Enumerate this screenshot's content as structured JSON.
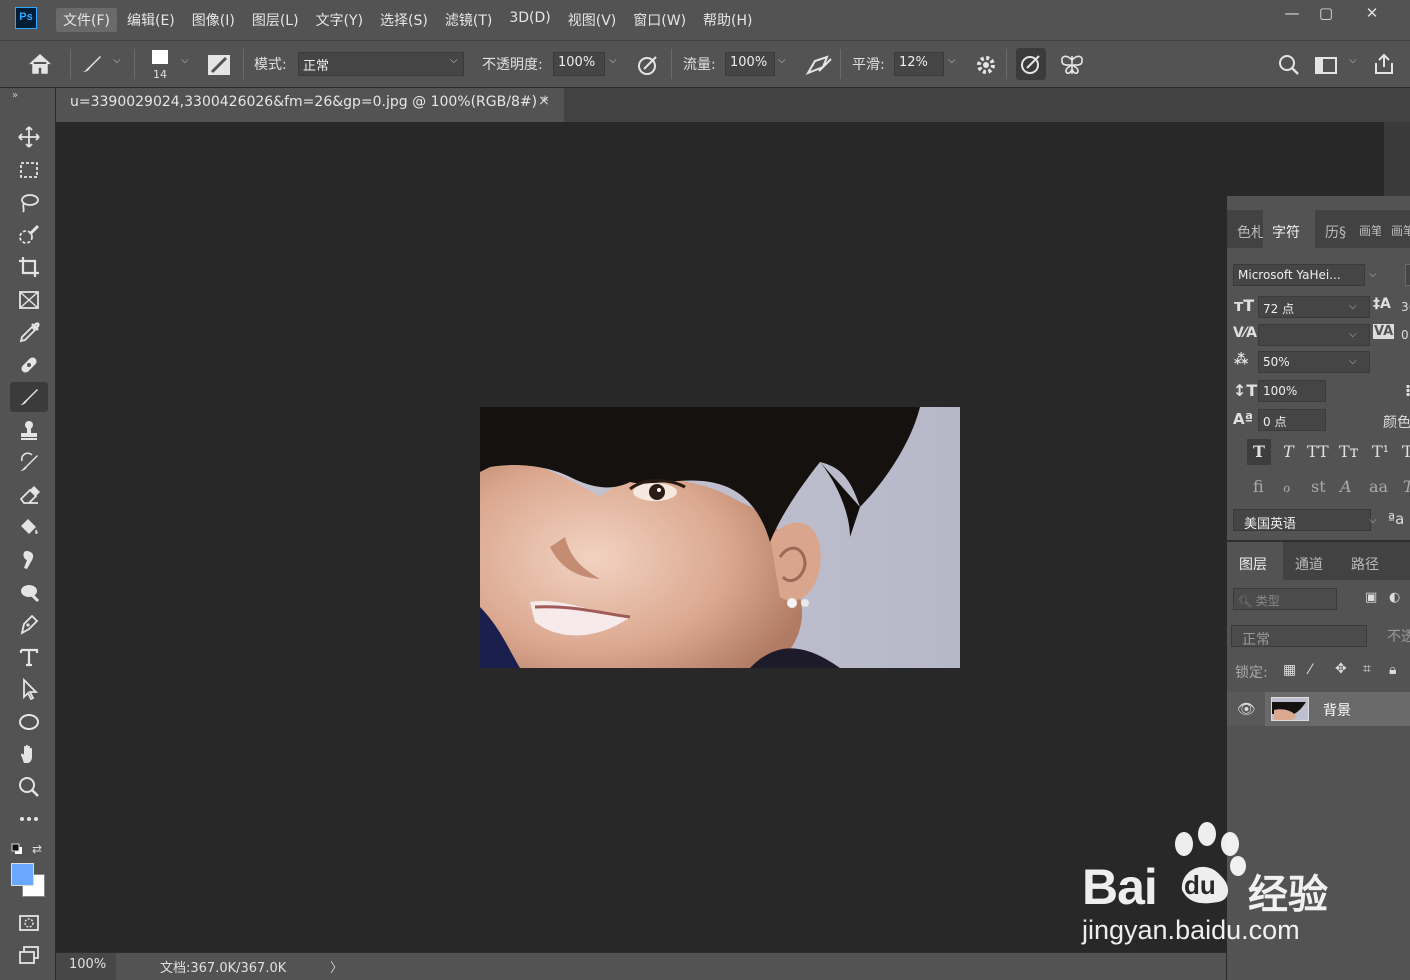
{
  "app": {
    "logo": "Ps"
  },
  "menu": [
    {
      "label": "文件(F)"
    },
    {
      "label": "编辑(E)"
    },
    {
      "label": "图像(I)"
    },
    {
      "label": "图层(L)"
    },
    {
      "label": "文字(Y)"
    },
    {
      "label": "选择(S)"
    },
    {
      "label": "滤镜(T)"
    },
    {
      "label": "3D(D)"
    },
    {
      "label": "视图(V)"
    },
    {
      "label": "窗口(W)"
    },
    {
      "label": "帮助(H)"
    }
  ],
  "window_controls": {
    "minimize": "—",
    "maximize": "▢",
    "close": "✕"
  },
  "options": {
    "brush_size": "14",
    "mode_label": "模式:",
    "mode_value": "正常",
    "opacity_label": "不透明度:",
    "opacity_value": "100%",
    "flow_label": "流量:",
    "flow_value": "100%",
    "smooth_label": "平滑:",
    "smooth_value": "12%"
  },
  "document": {
    "tab_title": "u=3390029024,3300426026&fm=26&gp=0.jpg @ 100%(RGB/8#) *",
    "close": "×"
  },
  "status": {
    "zoom": "100%",
    "doc_size": "文档:367.0K/367.0K",
    "arrow": "〉"
  },
  "character_panel": {
    "tabs": [
      {
        "label": "色札"
      },
      {
        "label": "字符"
      },
      {
        "label": "历§"
      },
      {
        "label": "画笔"
      },
      {
        "label": "画笔"
      }
    ],
    "font_family": "Microsoft YaHei...",
    "font_size": "72 点",
    "leading_partial": "3(",
    "tracking_partial": "0",
    "kerning": "",
    "vertical_scale": "50%",
    "horizontal_scale": "100%",
    "baseline_shift": "0 点",
    "color_label_partial": "颜色",
    "language": "美国英语",
    "aa_label": "ªa",
    "style_buttons": [
      "T",
      "T",
      "TT",
      "Tт",
      "T¹",
      "T"
    ],
    "opentype_buttons": [
      "ﬁ",
      "ℴ",
      "st",
      "A",
      "aa",
      "T"
    ]
  },
  "layers_panel": {
    "tabs": [
      {
        "label": "图层"
      },
      {
        "label": "通道"
      },
      {
        "label": "路径"
      }
    ],
    "filter_placeholder": "类型",
    "blend_mode": "正常",
    "opacity_partial": "不透",
    "lock_label": "锁定:",
    "layers": [
      {
        "name": "背景"
      }
    ]
  },
  "watermark": {
    "brand": "Bai",
    "brand2": "du",
    "cn": "经验",
    "url": "jingyan.baidu.com"
  },
  "colors": {
    "foreground": "#6aa8ff",
    "background": "#ffffff"
  }
}
